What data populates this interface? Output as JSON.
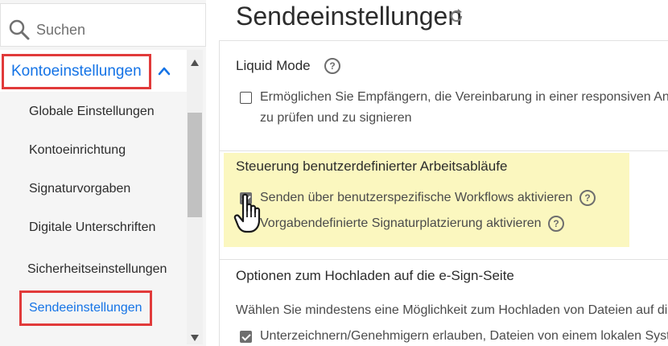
{
  "sidebar": {
    "search": {
      "placeholder": "Suchen"
    },
    "section": {
      "label": "Kontoeinstellungen"
    },
    "items": [
      {
        "label": "Globale Einstellungen"
      },
      {
        "label": "Kontoeinrichtung"
      },
      {
        "label": "Signaturvorgaben"
      },
      {
        "label": "Digitale Unterschriften"
      },
      {
        "label": "Sicherheitseinstellungen"
      },
      {
        "label": "Sendeeinstellungen"
      }
    ],
    "active_index": 5
  },
  "main": {
    "title": "Sendeeinstellungen",
    "sections": [
      {
        "title": "Liquid Mode",
        "options": [
          {
            "text_line1": "Ermöglichen Sie Empfängern, die Vereinbarung in einer responsiven Ansi",
            "text_line2": "zu prüfen und zu signieren",
            "checked": false
          }
        ]
      },
      {
        "title": "Steuerung benutzerdefinierter Arbeitsabläufe",
        "options": [
          {
            "text": "Senden über benutzerspezifische Workflows aktivieren",
            "checked": true
          },
          {
            "text": "Vorgabendefinierte Signaturplatzierung aktivieren",
            "checked": false
          }
        ]
      },
      {
        "title": "Optionen zum Hochladen auf die e-Sign-Seite",
        "description": "Wählen Sie mindestens eine Möglichkeit zum Hochladen von Dateien auf die",
        "options": [
          {
            "text": "Unterzeichnern/Genehmigern erlauben, Dateien von einem lokalen Syste",
            "checked": true
          }
        ]
      }
    ]
  },
  "colors": {
    "accent": "#1473e6",
    "annotation_red": "#e13a3a",
    "highlight": "#fbf7bf"
  },
  "icons": {
    "search": "search-icon",
    "chevron": "chevron-up-icon",
    "refresh": "refresh-icon",
    "help": "help-icon",
    "cursor": "hand-cursor-icon"
  }
}
